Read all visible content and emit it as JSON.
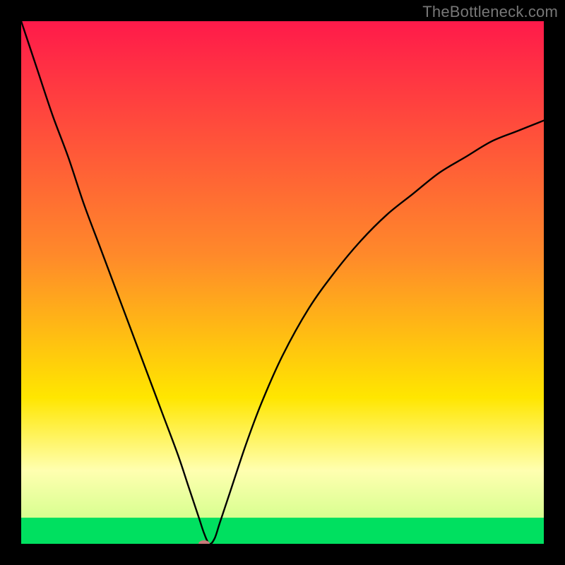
{
  "watermark": "TheBottleneck.com",
  "chart_data": {
    "type": "line",
    "title": "",
    "xlabel": "",
    "ylabel": "",
    "xlim": [
      0,
      100
    ],
    "ylim": [
      0,
      100
    ],
    "grid": false,
    "legend": false,
    "background_gradient": {
      "top": "#ff1a4a",
      "mid1": "#ff8a2a",
      "mid2": "#ffe600",
      "mid3": "#ffffb0",
      "bottom_band": "#00e060",
      "y_stops_percent_from_top": [
        0,
        45,
        72,
        86,
        95,
        100
      ]
    },
    "series": [
      {
        "name": "bottleneck-curve",
        "color": "#000000",
        "stroke_width": 2.4,
        "x": [
          0,
          3,
          6,
          9,
          12,
          15,
          18,
          21,
          24,
          27,
          30,
          32,
          34,
          35,
          36,
          37,
          38,
          40,
          43,
          46,
          50,
          55,
          60,
          65,
          70,
          75,
          80,
          85,
          90,
          95,
          100
        ],
        "y": [
          100,
          91,
          82,
          74,
          65,
          57,
          49,
          41,
          33,
          25,
          17,
          11,
          5,
          2,
          0,
          1,
          4,
          10,
          19,
          27,
          36,
          45,
          52,
          58,
          63,
          67,
          71,
          74,
          77,
          79,
          81
        ]
      }
    ],
    "marker": {
      "name": "bottleneck-point",
      "x": 35,
      "y": 0,
      "rx": 8,
      "ry": 5,
      "fill": "#c97a7a"
    }
  }
}
